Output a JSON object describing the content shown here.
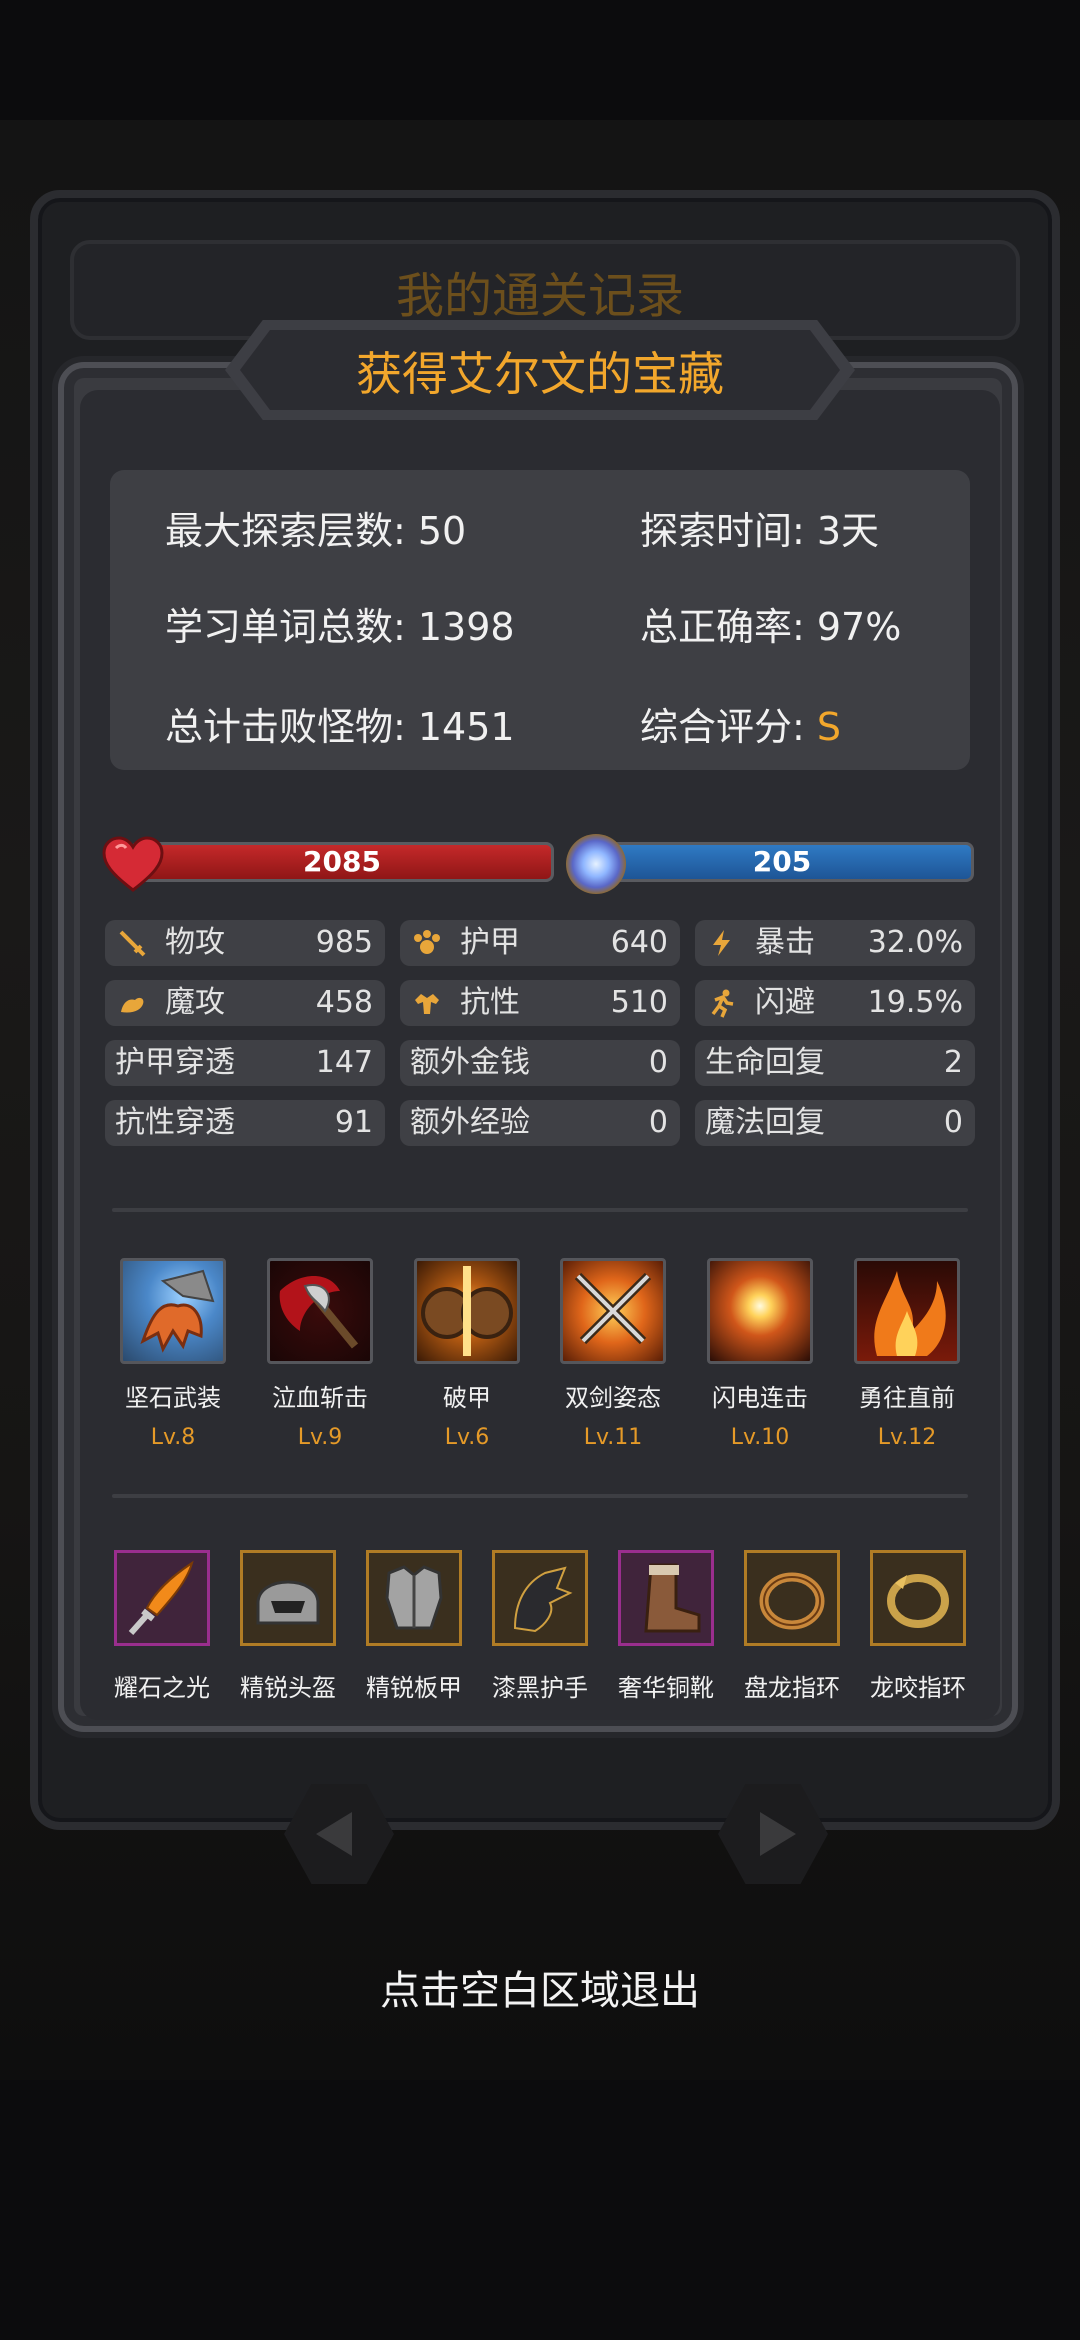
{
  "back_title": "我的通关记录",
  "title": "获得艾尔文的宝藏",
  "stats": {
    "max_floor": "最大探索层数: 50",
    "explore_time": "探索时间: 3天",
    "words_total": "学习单词总数: 1398",
    "accuracy": "总正确率: 97%",
    "monsters": "总计击败怪物: 1451",
    "rating_label": "综合评分: ",
    "rating_value": "S"
  },
  "hp": "2085",
  "mp": "205",
  "attributes": [
    {
      "label": "物攻",
      "value": "985",
      "icon": "sword-icon"
    },
    {
      "label": "护甲",
      "value": "640",
      "icon": "paw-icon"
    },
    {
      "label": "暴击",
      "value": "32.0%",
      "icon": "lightning-icon"
    },
    {
      "label": "魔攻",
      "value": "458",
      "icon": "magic-hand-icon"
    },
    {
      "label": "抗性",
      "value": "510",
      "icon": "muscle-icon"
    },
    {
      "label": "闪避",
      "value": "19.5%",
      "icon": "running-icon"
    },
    {
      "label": "护甲穿透",
      "value": "147"
    },
    {
      "label": "额外金钱",
      "value": "0"
    },
    {
      "label": "生命回复",
      "value": "2"
    },
    {
      "label": "抗性穿透",
      "value": "91"
    },
    {
      "label": "额外经验",
      "value": "0"
    },
    {
      "label": "魔法回复",
      "value": "0"
    }
  ],
  "skills": [
    {
      "name": "坚石武装",
      "level": "Lv.8"
    },
    {
      "name": "泣血斩击",
      "level": "Lv.9"
    },
    {
      "name": "破甲",
      "level": "Lv.6"
    },
    {
      "name": "双剑姿态",
      "level": "Lv.11"
    },
    {
      "name": "闪电连击",
      "level": "Lv.10"
    },
    {
      "name": "勇往直前",
      "level": "Lv.12"
    }
  ],
  "equipment": [
    {
      "name": "耀石之光",
      "rarity": "epic"
    },
    {
      "name": "精锐头盔",
      "rarity": "legendary"
    },
    {
      "name": "精锐板甲",
      "rarity": "legendary"
    },
    {
      "name": "漆黑护手",
      "rarity": "legendary"
    },
    {
      "name": "奢华铜靴",
      "rarity": "epic"
    },
    {
      "name": "盘龙指环",
      "rarity": "legendary"
    },
    {
      "name": "龙咬指环",
      "rarity": "legendary"
    }
  ],
  "exit_hint": "点击空白区域退出",
  "colors": {
    "accent": "#f2a72c",
    "hp": "#c5292a",
    "mp": "#2f7ac4",
    "legendary": "#b07c25",
    "epic": "#9a2e8e"
  }
}
